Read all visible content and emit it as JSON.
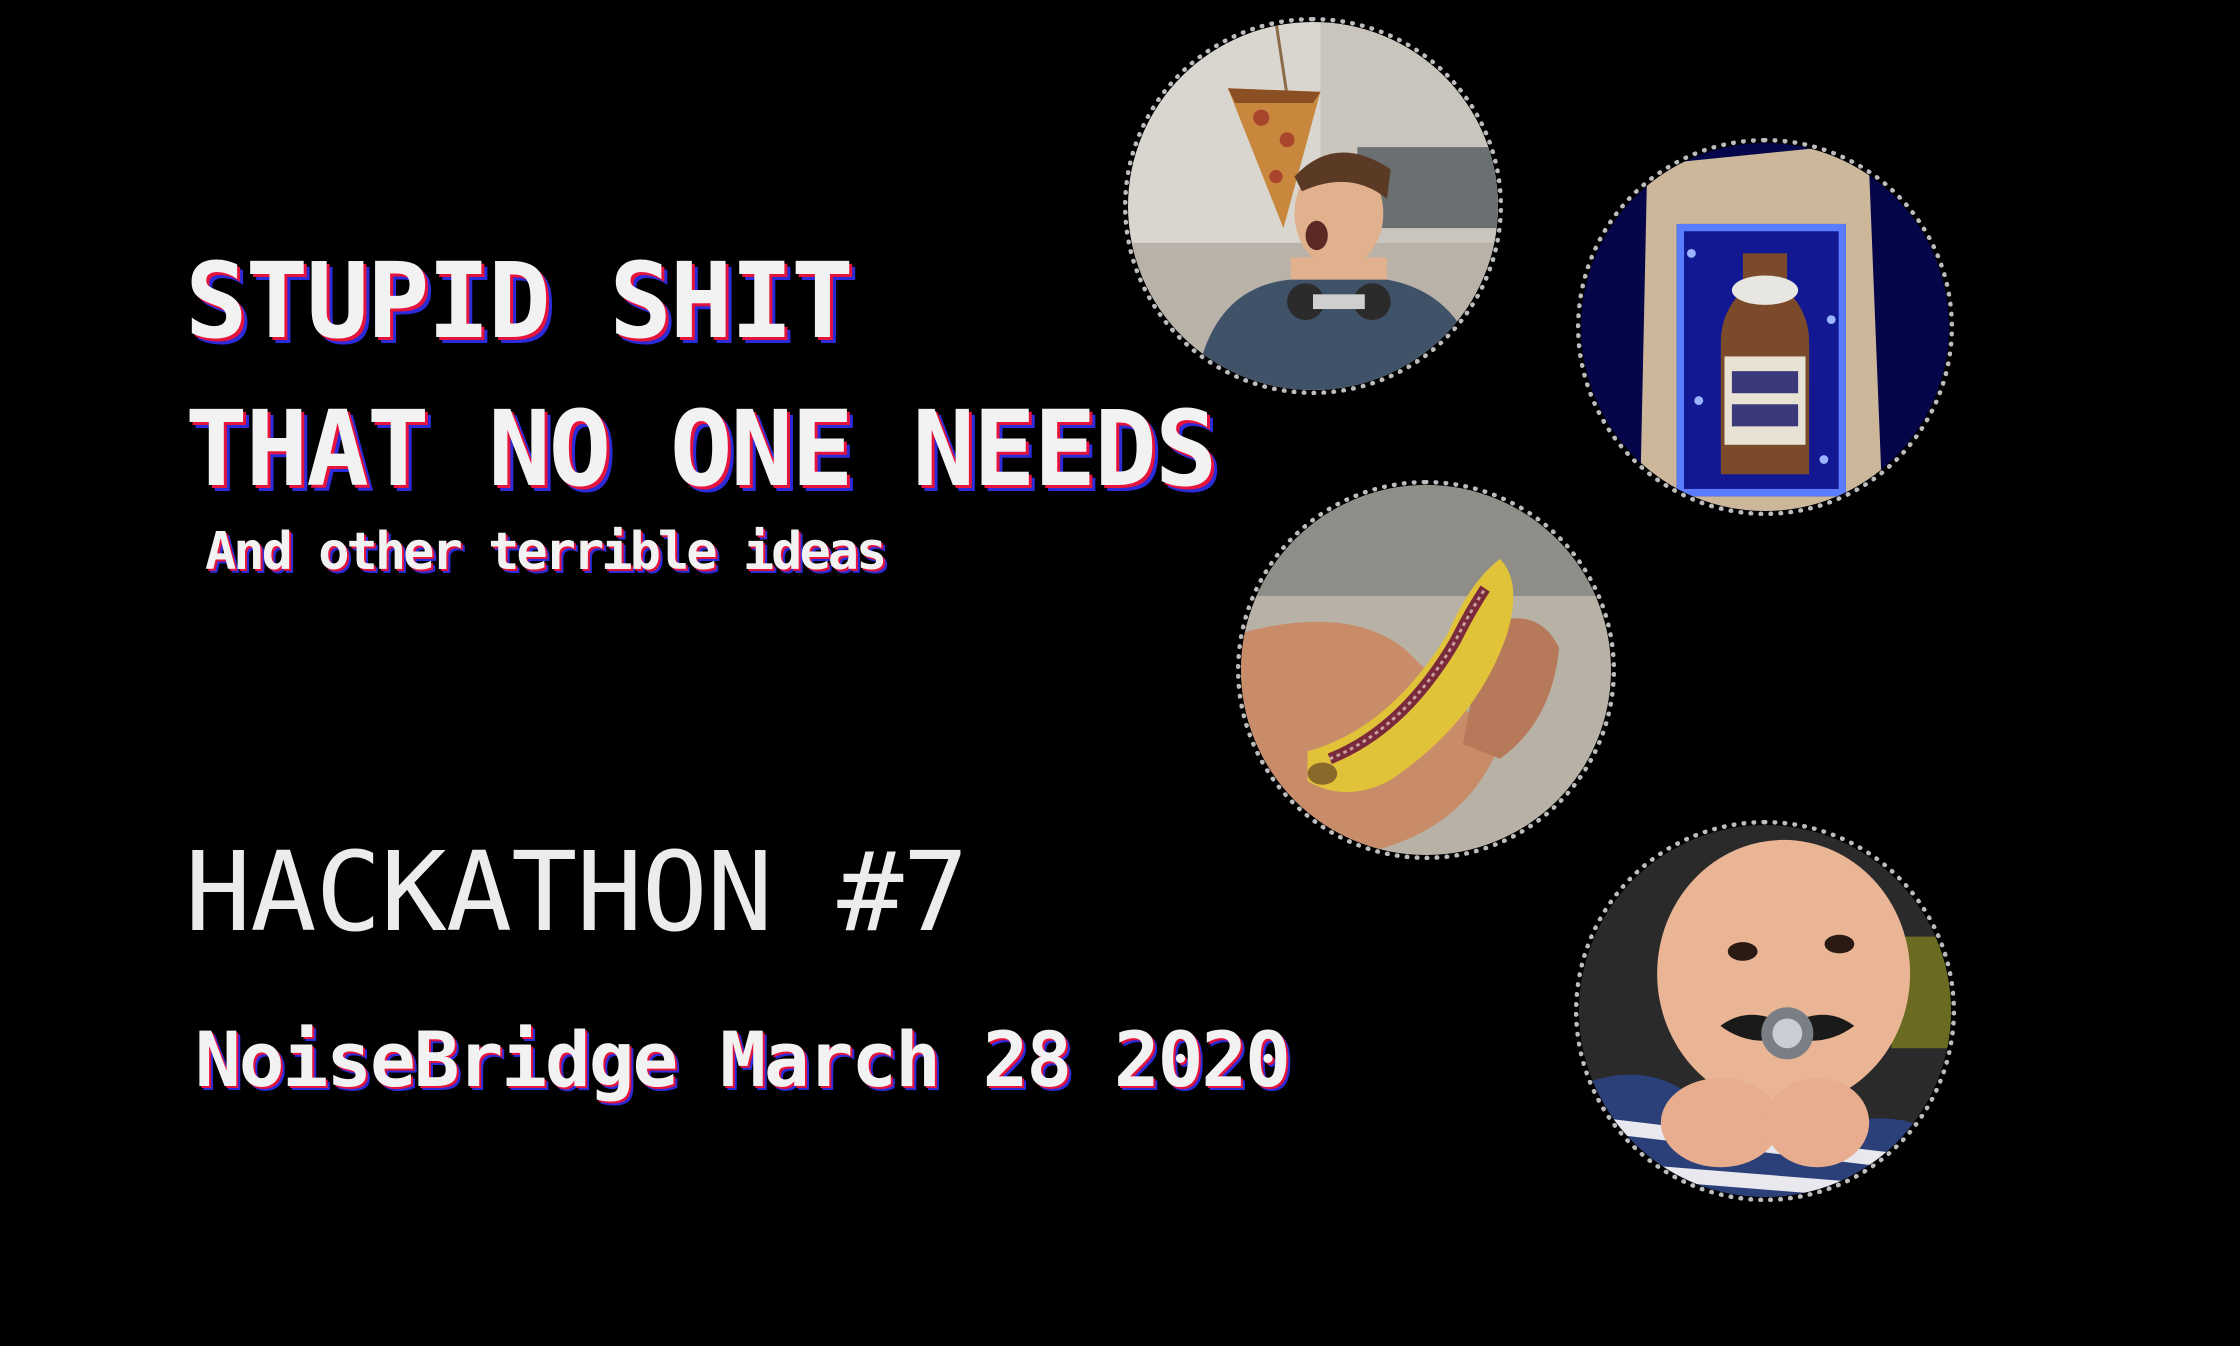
{
  "slide": {
    "title_line_1": "STUPID SHIT",
    "title_line_2": "THAT NO ONE NEEDS",
    "subtitle": "And other terrible ideas",
    "event_name": "HACKATHON #7",
    "event_details": "NoiseBridge March 28 2020"
  },
  "colors": {
    "background": "#000000",
    "text": "#f2f2f2",
    "shadow_red": "#e5143c",
    "shadow_blue": "#2b2bd9",
    "photo_border": "#bdbdbd"
  },
  "photos": [
    {
      "name": "pizza-photo",
      "depicts": "man catching a dangling slice of pizza"
    },
    {
      "name": "club-mate-photo",
      "depicts": "Club-Mate bottle in a blue-lit box"
    },
    {
      "name": "banana-photo",
      "depicts": "banana with a zipper"
    },
    {
      "name": "baby-photo",
      "depicts": "baby with a mustache pacifier"
    }
  ]
}
